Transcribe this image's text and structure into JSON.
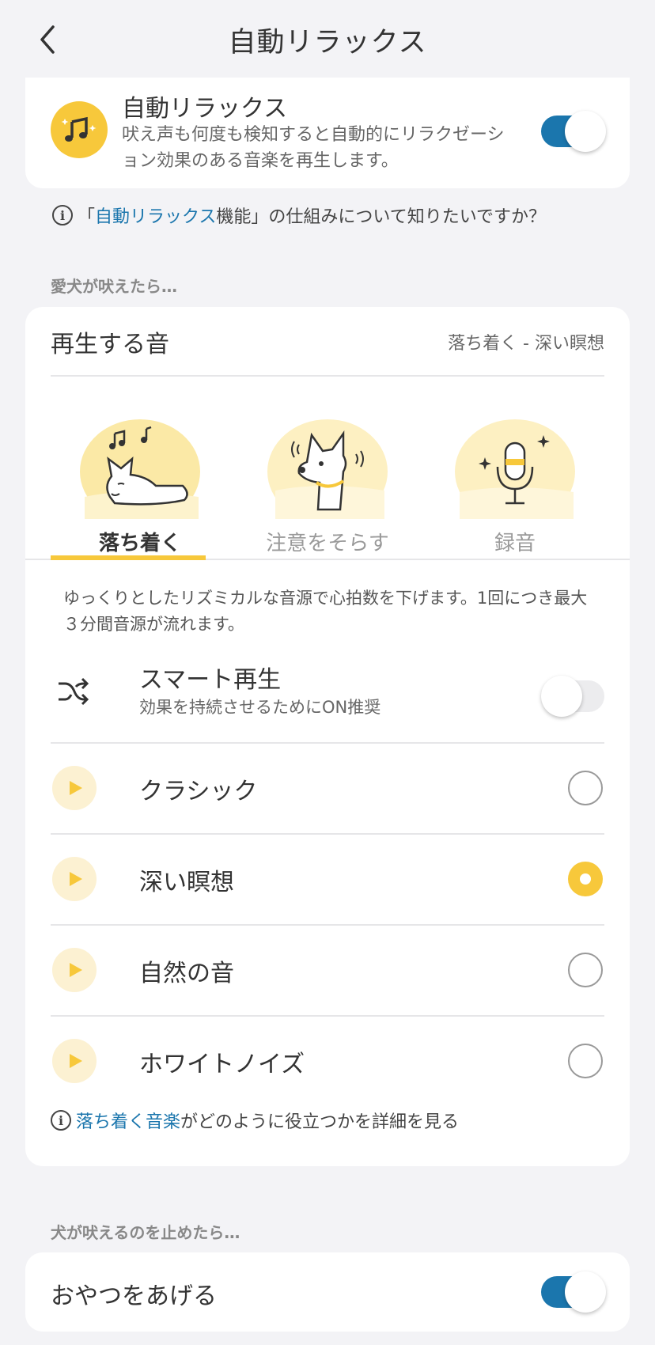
{
  "header": {
    "title": "自動リラックス"
  },
  "auto_relax": {
    "title": "自動リラックス",
    "description": "吠え声も何度も検知すると自動的にリラクゼーション効果のある音楽を再生します。",
    "enabled": true
  },
  "info_how": {
    "prefix": "「",
    "link": "自動リラックス",
    "suffix": "機能」の仕組みについて知りたいですか？"
  },
  "section_barking": "愛犬が吠えたら…",
  "sound_settings": {
    "label": "再生する音",
    "value": "落ち着く - 深い瞑想"
  },
  "modes": [
    {
      "label": "落ち着く",
      "active": true
    },
    {
      "label": "注意をそらす",
      "active": false
    },
    {
      "label": "録音",
      "active": false
    }
  ],
  "mode_description": "ゆっくりとしたリズミカルな音源で心拍数を下げます。1回につき最大３分間音源が流れます。",
  "smart_play": {
    "title": "スマート再生",
    "subtitle": "効果を持続させるためにON推奨",
    "enabled": false
  },
  "sounds": [
    {
      "label": "クラシック",
      "selected": false
    },
    {
      "label": "深い瞑想",
      "selected": true
    },
    {
      "label": "自然の音",
      "selected": false
    },
    {
      "label": "ホワイトノイズ",
      "selected": false
    }
  ],
  "info_music": {
    "link": "落ち着く音楽",
    "suffix": "がどのように役立つかを詳細を見る"
  },
  "section_stopped": "犬が吠えるのを止めたら…",
  "treat": {
    "label": "おやつをあげる",
    "enabled": true
  },
  "colors": {
    "accent": "#f7c83b",
    "link": "#1b76ad",
    "toggle_on": "#1b76ad"
  }
}
